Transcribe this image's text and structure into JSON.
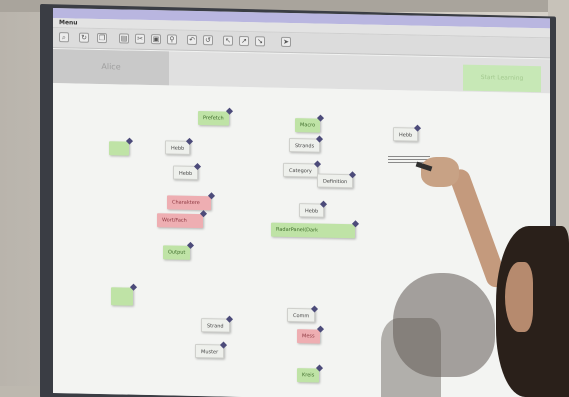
{
  "app": {
    "menu_label": "Menu",
    "tab_label": "Alice",
    "corner_button_label": "Start Learning"
  },
  "toolbar": {
    "buttons": [
      "magnify",
      "redo",
      "copy",
      "print",
      "cut",
      "paste",
      "filter",
      "undo",
      "refresh",
      "tool-a",
      "tool-b",
      "tool-c",
      "tool-d",
      "tool-e",
      "cursor"
    ]
  },
  "cards": {
    "c1": "Prefetch",
    "c2": "Macro",
    "c3": "Hebb",
    "c4": "Hebb",
    "c5": "Strands",
    "c6": "Hebb",
    "c7": "Category",
    "c8": "Definition",
    "c9": "Charaktere",
    "c10": "Wort/Fach",
    "c11": "Hebb",
    "c12": "RadarPanel(Dark",
    "c13": "Output",
    "c14": "Strand",
    "c15": "Mess",
    "c16": "Comm",
    "c17": "Kreis",
    "c18": "Muster",
    "c19": "",
    "c20": ""
  },
  "colors": {
    "screen_bg": "#f3f4f2",
    "card_green": "#bfe3a6",
    "card_pink": "#eeaeb2",
    "card_white": "#eef0ec",
    "titlebar": "#9a95d6"
  }
}
